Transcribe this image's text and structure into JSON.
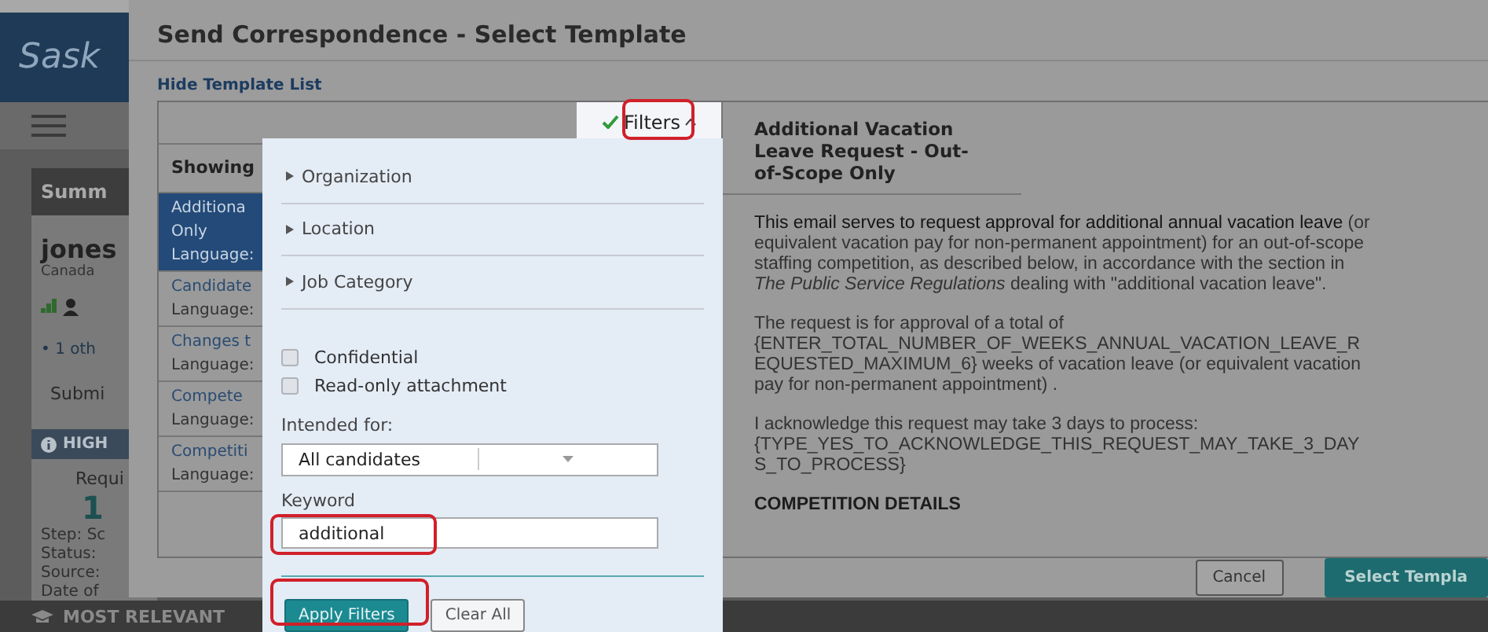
{
  "background_app": {
    "logo": "Sask",
    "summary": {
      "title": "Summ",
      "name": "jones",
      "country": "Canada",
      "bullet": "• 1 oth",
      "submit": "Submi"
    },
    "highlights": {
      "title": "HIGH",
      "label": "Requi",
      "value": "1",
      "details": [
        "Step: Sc",
        "Status: ",
        "Source:",
        "Date of"
      ]
    },
    "bottom_bar": {
      "title": "MOST RELEVANT"
    }
  },
  "dialog": {
    "title": "Send Correspondence - Select Template",
    "hide_link": "Hide Template List",
    "filters_toggle": {
      "label": "Filters",
      "active": true
    },
    "list_header": "Showing",
    "templates": [
      {
        "lines": [
          "Additiona",
          "Only",
          "Language:"
        ],
        "selected": true
      },
      {
        "lines": [
          "Candidate",
          "Language:"
        ],
        "selected": false
      },
      {
        "lines": [
          "Changes t",
          "Language:"
        ],
        "selected": false
      },
      {
        "lines": [
          "Compete",
          "Language:"
        ],
        "selected": false
      },
      {
        "lines": [
          "Competiti",
          "Language:"
        ],
        "selected": false
      }
    ],
    "preview": {
      "title": "Additional Vacation Leave Request - Out-of-Scope Only",
      "paragraphs": [
        "**This email serves to request approval for additional annual vacation leave** (or equivalent vacation pay for non-permanent appointment) for an out-of-scope staffing competition, as described below, in accordance with the section in *The Public Service Regulations* dealing with \"additional vacation leave\".",
        "The request is for approval of a total of {ENTER_TOTAL_NUMBER_OF_WEEKS_ANNUAL_VACATION_LEAVE_REQUESTED_MAXIMUM_6} weeks of vacation leave (or equivalent vacation pay for non-permanent appointment) .",
        "I acknowledge this request may take 3 days to process: {TYPE_YES_TO_ACKNOWLEDGE_THIS_REQUEST_MAY_TAKE_3_DAYS_TO_PROCESS}"
      ],
      "heading": "COMPETITION DETAILS"
    },
    "buttons": [
      {
        "label": "Cancel",
        "kind": "secondary"
      },
      {
        "label": "Select Templa",
        "kind": "primary"
      }
    ]
  },
  "filter_panel": {
    "sections": [
      {
        "label": "Organization",
        "expanded": false
      },
      {
        "label": "Location",
        "expanded": false
      },
      {
        "label": "Job Category",
        "expanded": false
      }
    ],
    "checkboxes": [
      {
        "label": "Confidential",
        "checked": false
      },
      {
        "label": "Read-only attachment",
        "checked": false
      }
    ],
    "intended_for": {
      "label": "Intended for:",
      "value": "All candidates"
    },
    "keyword": {
      "label": "Keyword",
      "value": "additional"
    },
    "buttons": [
      {
        "label": "Apply Filters",
        "kind": "primary"
      },
      {
        "label": "Clear All",
        "kind": "secondary"
      }
    ]
  }
}
